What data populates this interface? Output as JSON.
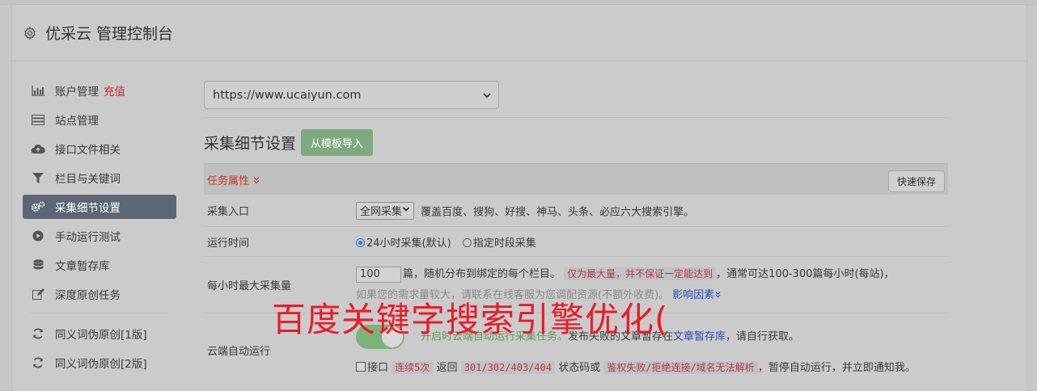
{
  "header": {
    "title": "优采云 管理控制台"
  },
  "sidebar": {
    "items": [
      {
        "label": "账户管理",
        "tag": "充值",
        "icon": "bar-chart-icon"
      },
      {
        "label": "站点管理",
        "icon": "server-icon"
      },
      {
        "label": "接口文件相关",
        "icon": "cloud-upload-icon"
      },
      {
        "label": "栏目与关键词",
        "icon": "filter-icon"
      },
      {
        "label": "采集细节设置",
        "icon": "gears-icon",
        "active": true
      },
      {
        "label": "手动运行测试",
        "icon": "play-circle-icon"
      },
      {
        "label": "文章暂存库",
        "icon": "database-icon"
      },
      {
        "label": "深度原创任务",
        "icon": "edit-icon"
      }
    ],
    "items2": [
      {
        "label": "同义词伪原创[1版]",
        "icon": "refresh-icon"
      },
      {
        "label": "同义词伪原创[2版]",
        "icon": "refresh-icon"
      }
    ]
  },
  "main": {
    "site_select": "https://www.ucaiyun.com",
    "section_title": "采集细节设置",
    "import_button": "从模板导入",
    "task_attr": "任务属性",
    "save_button": "快速保存",
    "rows": {
      "entry": {
        "label": "采集入口",
        "select": "全网采集",
        "desc": "覆盖百度、搜狗、好搜、神马、头条、必应六大搜索引擎。"
      },
      "time": {
        "label": "运行时间",
        "opt1": "24小时采集(默认)",
        "opt2": "指定时段采集"
      },
      "max": {
        "label": "每小时最大采集量",
        "value": "100",
        "t1": "篇，随机分布到绑定的每个栏目。",
        "code": "仅为最大量，并不保证一定能达到",
        "t2": "，通常可达100-300篇每小时(每站)，",
        "t3": "如果您的需求量较大，请联系在线客服为您调配资源(不额外收费)。",
        "link": "影响因素"
      },
      "cloud": {
        "label": "云端自动运行",
        "green_text": "开启时云端自动运行采集任务。",
        "t1": "发布失败的文章暂存在",
        "link": "文章暂存库",
        "t2": "，请自行获取。",
        "cb_label": "接口",
        "code1": "连续5次",
        "t3": "返回",
        "code2": "301/302/403/404",
        "t4": "状态码或",
        "code3": "鉴权失败/拒绝连接/域名无法解析",
        "t5": "，暂停自动运行，并立即通知我。"
      }
    }
  },
  "overlay_text": "百度关键字搜索引擎优化(",
  "colors": {
    "accent_green": "#7fa97f",
    "active_nav": "#5d6675",
    "warning_red": "#c0392b",
    "link_blue": "#2d4bb5",
    "overlay_red": "#ea1b2a"
  }
}
